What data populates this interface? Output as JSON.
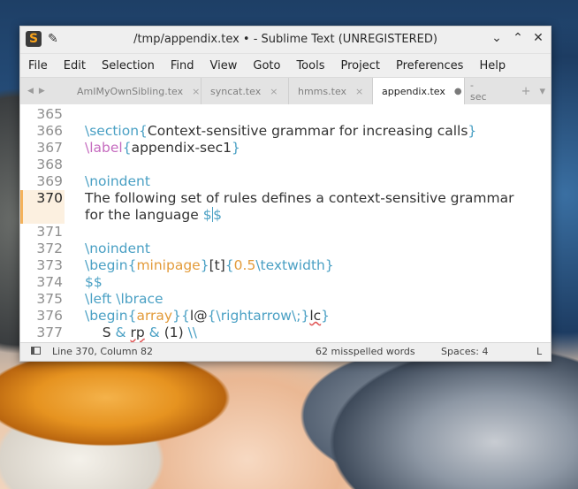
{
  "window": {
    "title": "/tmp/appendix.tex • - Sublime Text (UNREGISTERED)"
  },
  "menu": [
    "File",
    "Edit",
    "Selection",
    "Find",
    "View",
    "Goto",
    "Tools",
    "Project",
    "Preferences",
    "Help"
  ],
  "tabs": [
    {
      "label": "AmIMyOwnSibling.tex",
      "close": "×",
      "active": false
    },
    {
      "label": "syncat.tex",
      "close": "×",
      "active": false
    },
    {
      "label": "hmms.tex",
      "close": "×",
      "active": false
    },
    {
      "label": "appendix.tex",
      "close": "●",
      "active": true
    },
    {
      "label": "-sec",
      "close": "",
      "active": false
    }
  ],
  "editor": {
    "current_line": 370,
    "lines": [
      {
        "num": "365",
        "text": ""
      },
      {
        "num": "366",
        "parts": [
          [
            "\\section",
            "kw"
          ],
          [
            "{",
            "br"
          ],
          [
            "Context-sensitive grammar for increasing calls",
            ""
          ],
          [
            "}",
            "br"
          ]
        ]
      },
      {
        "num": "367",
        "parts": [
          [
            "\\label",
            "lbl"
          ],
          [
            "{",
            "br"
          ],
          [
            "appendix-sec1",
            ""
          ],
          [
            "}",
            "br"
          ]
        ]
      },
      {
        "num": "368",
        "text": ""
      },
      {
        "num": "369",
        "parts": [
          [
            "\\noindent",
            "kw"
          ]
        ]
      },
      {
        "num": "370",
        "parts": [
          [
            "The following set of rules defines a context-sensitive grammar",
            ""
          ]
        ]
      },
      {
        "num": "",
        "parts": [
          [
            "for the language ",
            ""
          ],
          [
            "$$",
            "kw"
          ]
        ]
      },
      {
        "num": "371",
        "text": ""
      },
      {
        "num": "372",
        "parts": [
          [
            "\\noindent",
            "kw"
          ]
        ]
      },
      {
        "num": "373",
        "parts": [
          [
            "\\begin",
            "kw"
          ],
          [
            "{",
            "br"
          ],
          [
            "minipage",
            "arg"
          ],
          [
            "}",
            "br"
          ],
          [
            "[",
            ""
          ],
          [
            "t",
            ""
          ],
          [
            "]",
            ""
          ],
          [
            "{",
            "br"
          ],
          [
            "0.5",
            "arg"
          ],
          [
            "\\textwidth",
            "kw"
          ],
          [
            "}",
            "br"
          ]
        ]
      },
      {
        "num": "374",
        "parts": [
          [
            "$$",
            "kw"
          ]
        ]
      },
      {
        "num": "375",
        "parts": [
          [
            "\\left \\lbrace",
            "kw"
          ]
        ]
      },
      {
        "num": "376",
        "parts": [
          [
            "\\begin",
            "kw"
          ],
          [
            "{",
            "br"
          ],
          [
            "array",
            "arg"
          ],
          [
            "}",
            "br"
          ],
          [
            "{",
            "br"
          ],
          [
            "l@",
            ""
          ],
          [
            "{",
            "br"
          ],
          [
            "\\rightarrow",
            "kw"
          ],
          [
            "\\;",
            "kw"
          ],
          [
            "}",
            "br"
          ],
          [
            "lc",
            ""
          ],
          [
            "}",
            "br"
          ]
        ]
      },
      {
        "num": "377",
        "parts": [
          [
            "    S ",
            ""
          ],
          [
            "&",
            "kw"
          ],
          [
            " rp ",
            ""
          ],
          [
            "&",
            "kw"
          ],
          [
            " (1) ",
            ""
          ],
          [
            "\\\\",
            "kw"
          ]
        ]
      }
    ]
  },
  "status": {
    "position": "Line 370, Column 82",
    "spelling": "62 misspelled words",
    "indent": "Spaces: 4",
    "syntax": "L"
  }
}
